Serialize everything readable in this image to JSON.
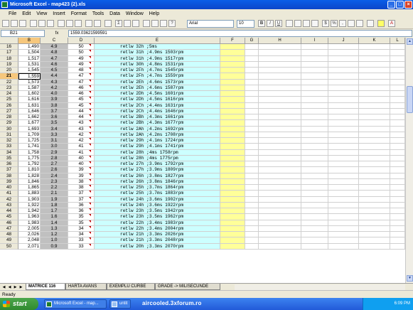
{
  "window": {
    "title": "Microsoft Excel - map423 (2).xls"
  },
  "menu": [
    "File",
    "Edit",
    "View",
    "Insert",
    "Format",
    "Tools",
    "Data",
    "Window",
    "Help"
  ],
  "toolbar": {
    "font": "Arial",
    "size": "10"
  },
  "formula_bar": {
    "name_box": "B21",
    "fx": "fx",
    "value": "1559.03621599591"
  },
  "columns": [
    "B",
    "C",
    "D",
    "E",
    "F",
    "G",
    "H",
    "I",
    "J",
    "K",
    "L"
  ],
  "rows": [
    {
      "n": "16",
      "b": "1,490",
      "c": "4.9",
      "d": "50",
      "e": "retlw 32h    ;5ms"
    },
    {
      "n": "17",
      "b": "1,504",
      "c": "4.8",
      "d": "50",
      "e": "retlw 31h    ;4.9ms     1503rpm"
    },
    {
      "n": "18",
      "b": "1,517",
      "c": "4.7",
      "d": "49",
      "e": "retlw 31h    ;4.9ms     1517rpm"
    },
    {
      "n": "19",
      "b": "1,531",
      "c": "4.6",
      "d": "49",
      "e": "retlw 30h    ;4.8ms     1531rpm"
    },
    {
      "n": "20",
      "b": "1,545",
      "c": "4.5",
      "d": "48",
      "e": "retlw 2Fh    ;4.7ms     1545rpm"
    },
    {
      "n": "21",
      "b": "1,559",
      "c": "4.4",
      "d": "47",
      "e": "retlw 2Fh    ;4.7ms     1559rpm"
    },
    {
      "n": "22",
      "b": "1,573",
      "c": "4.3",
      "d": "47",
      "e": "retlw 2Eh    ;4.6ms     1573rpm"
    },
    {
      "n": "23",
      "b": "1,587",
      "c": "4.2",
      "d": "46",
      "e": "retlw 2Eh    ;4.6ms     1587rpm"
    },
    {
      "n": "24",
      "b": "1,602",
      "c": "4.0",
      "d": "46",
      "e": "retlw 2Dh    ;4.5ms     1601rpm"
    },
    {
      "n": "25",
      "b": "1,616",
      "c": "3.9",
      "d": "45",
      "e": "retlw 2Dh    ;4.5ms     1616rpm"
    },
    {
      "n": "26",
      "b": "1,631",
      "c": "3.8",
      "d": "45",
      "e": "retlw 2Ch    ;4.4ms     1631rpm"
    },
    {
      "n": "27",
      "b": "1,646",
      "c": "3.7",
      "d": "44",
      "e": "retlw 2Ch    ;4.4ms     1646rpm"
    },
    {
      "n": "28",
      "b": "1,662",
      "c": "3.6",
      "d": "44",
      "e": "retlw 2Bh    ;4.3ms     1661rpm"
    },
    {
      "n": "29",
      "b": "1,677",
      "c": "3.5",
      "d": "43",
      "e": "retlw 2Bh    ;4.3ms     1677rpm"
    },
    {
      "n": "30",
      "b": "1,693",
      "c": "3.4",
      "d": "43",
      "e": "retlw 2Ah    ;4.2ms     1692rpm"
    },
    {
      "n": "31",
      "b": "1,709",
      "c": "3.3",
      "d": "42",
      "e": "retlw 2Ah    ;4.2ms     1708rpm"
    },
    {
      "n": "32",
      "b": "1,725",
      "c": "3.1",
      "d": "42",
      "e": "retlw 29h    ;4.1ms     1724rpm"
    },
    {
      "n": "33",
      "b": "1,741",
      "c": "3.0",
      "d": "41",
      "e": "retlw 29h    ;4.1ms     1741rpm"
    },
    {
      "n": "34",
      "b": "1,758",
      "c": "2.9",
      "d": "41",
      "e": "retlw 28h    ;4ms    1758rpm"
    },
    {
      "n": "35",
      "b": "1,775",
      "c": "2.8",
      "d": "40",
      "e": "retlw 28h    ;4ms    1775rpm"
    },
    {
      "n": "36",
      "b": "1,792",
      "c": "2.7",
      "d": "40",
      "e": "retlw 27h    ;3.9ms     1792rpm"
    },
    {
      "n": "37",
      "b": "1,810",
      "c": "2.6",
      "d": "39",
      "e": "retlw 27h    ;3.9ms     1809rpm"
    },
    {
      "n": "38",
      "b": "1,828",
      "c": "2.4",
      "d": "39",
      "e": "retlw 26h    ;3.8ms     1827rpm"
    },
    {
      "n": "39",
      "b": "1,846",
      "c": "2.3",
      "d": "38",
      "e": "retlw 26h    ;3.8ms     1846rpm"
    },
    {
      "n": "40",
      "b": "1,865",
      "c": "2.2",
      "d": "38",
      "e": "retlw 25h    ;3.7ms     1864rpm"
    },
    {
      "n": "41",
      "b": "1,883",
      "c": "2.1",
      "d": "37",
      "e": "retlw 25h    ;3.7ms     1883rpm"
    },
    {
      "n": "42",
      "b": "1,903",
      "c": "1.9",
      "d": "37",
      "e": "retlw 24h    ;3.6ms     1902rpm"
    },
    {
      "n": "43",
      "b": "1,922",
      "c": "1.8",
      "d": "36",
      "e": "retlw 24h    ;3.6ms     1922rpm"
    },
    {
      "n": "44",
      "b": "1,942",
      "c": "1.7",
      "d": "36",
      "e": "retlw 23h    ;3.5ms     1942rpm"
    },
    {
      "n": "45",
      "b": "1,963",
      "c": "1.6",
      "d": "35",
      "e": "retlw 23h    ;3.5ms     1962rpm"
    },
    {
      "n": "46",
      "b": "1,983",
      "c": "1.4",
      "d": "35",
      "e": "retlw 22h    ;3.4ms     1983rpm"
    },
    {
      "n": "47",
      "b": "2,005",
      "c": "1.3",
      "d": "34",
      "e": "retlw 22h    ;3.4ms     2004rpm"
    },
    {
      "n": "48",
      "b": "2,026",
      "c": "1.2",
      "d": "34",
      "e": "retlw 21h    ;3.3ms     2026rpm"
    },
    {
      "n": "49",
      "b": "2,048",
      "c": "1.0",
      "d": "33",
      "e": "retlw 21h    ;3.3ms     2048rpm"
    },
    {
      "n": "50",
      "b": "2,071",
      "c": "0.9",
      "d": "33",
      "e": "retlw 20h    ;3.3ms     2070rpm"
    }
  ],
  "sheet_tabs": [
    "MATRICE 116",
    "HARTA AVANS",
    "EXEMPLU CURBE",
    "GRADE -> MILISECUNDE"
  ],
  "status": "Ready",
  "taskbar": {
    "start": "start",
    "tasks": [
      "Microsoft Excel - map...",
      "untit"
    ],
    "overlay_text": "aircooled.3xforum.ro",
    "clock": "6:09 PM"
  }
}
